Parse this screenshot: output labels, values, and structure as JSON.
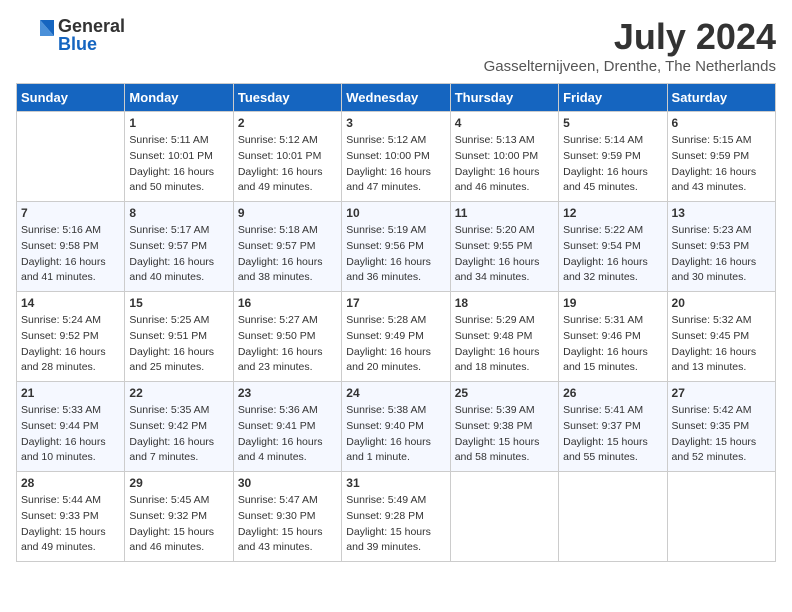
{
  "header": {
    "logo_general": "General",
    "logo_blue": "Blue",
    "month_year": "July 2024",
    "location": "Gasselternijveen, Drenthe, The Netherlands"
  },
  "days_of_week": [
    "Sunday",
    "Monday",
    "Tuesday",
    "Wednesday",
    "Thursday",
    "Friday",
    "Saturday"
  ],
  "weeks": [
    [
      {
        "day": "",
        "content": ""
      },
      {
        "day": "1",
        "content": "Sunrise: 5:11 AM\nSunset: 10:01 PM\nDaylight: 16 hours\nand 50 minutes."
      },
      {
        "day": "2",
        "content": "Sunrise: 5:12 AM\nSunset: 10:01 PM\nDaylight: 16 hours\nand 49 minutes."
      },
      {
        "day": "3",
        "content": "Sunrise: 5:12 AM\nSunset: 10:00 PM\nDaylight: 16 hours\nand 47 minutes."
      },
      {
        "day": "4",
        "content": "Sunrise: 5:13 AM\nSunset: 10:00 PM\nDaylight: 16 hours\nand 46 minutes."
      },
      {
        "day": "5",
        "content": "Sunrise: 5:14 AM\nSunset: 9:59 PM\nDaylight: 16 hours\nand 45 minutes."
      },
      {
        "day": "6",
        "content": "Sunrise: 5:15 AM\nSunset: 9:59 PM\nDaylight: 16 hours\nand 43 minutes."
      }
    ],
    [
      {
        "day": "7",
        "content": "Sunrise: 5:16 AM\nSunset: 9:58 PM\nDaylight: 16 hours\nand 41 minutes."
      },
      {
        "day": "8",
        "content": "Sunrise: 5:17 AM\nSunset: 9:57 PM\nDaylight: 16 hours\nand 40 minutes."
      },
      {
        "day": "9",
        "content": "Sunrise: 5:18 AM\nSunset: 9:57 PM\nDaylight: 16 hours\nand 38 minutes."
      },
      {
        "day": "10",
        "content": "Sunrise: 5:19 AM\nSunset: 9:56 PM\nDaylight: 16 hours\nand 36 minutes."
      },
      {
        "day": "11",
        "content": "Sunrise: 5:20 AM\nSunset: 9:55 PM\nDaylight: 16 hours\nand 34 minutes."
      },
      {
        "day": "12",
        "content": "Sunrise: 5:22 AM\nSunset: 9:54 PM\nDaylight: 16 hours\nand 32 minutes."
      },
      {
        "day": "13",
        "content": "Sunrise: 5:23 AM\nSunset: 9:53 PM\nDaylight: 16 hours\nand 30 minutes."
      }
    ],
    [
      {
        "day": "14",
        "content": "Sunrise: 5:24 AM\nSunset: 9:52 PM\nDaylight: 16 hours\nand 28 minutes."
      },
      {
        "day": "15",
        "content": "Sunrise: 5:25 AM\nSunset: 9:51 PM\nDaylight: 16 hours\nand 25 minutes."
      },
      {
        "day": "16",
        "content": "Sunrise: 5:27 AM\nSunset: 9:50 PM\nDaylight: 16 hours\nand 23 minutes."
      },
      {
        "day": "17",
        "content": "Sunrise: 5:28 AM\nSunset: 9:49 PM\nDaylight: 16 hours\nand 20 minutes."
      },
      {
        "day": "18",
        "content": "Sunrise: 5:29 AM\nSunset: 9:48 PM\nDaylight: 16 hours\nand 18 minutes."
      },
      {
        "day": "19",
        "content": "Sunrise: 5:31 AM\nSunset: 9:46 PM\nDaylight: 16 hours\nand 15 minutes."
      },
      {
        "day": "20",
        "content": "Sunrise: 5:32 AM\nSunset: 9:45 PM\nDaylight: 16 hours\nand 13 minutes."
      }
    ],
    [
      {
        "day": "21",
        "content": "Sunrise: 5:33 AM\nSunset: 9:44 PM\nDaylight: 16 hours\nand 10 minutes."
      },
      {
        "day": "22",
        "content": "Sunrise: 5:35 AM\nSunset: 9:42 PM\nDaylight: 16 hours\nand 7 minutes."
      },
      {
        "day": "23",
        "content": "Sunrise: 5:36 AM\nSunset: 9:41 PM\nDaylight: 16 hours\nand 4 minutes."
      },
      {
        "day": "24",
        "content": "Sunrise: 5:38 AM\nSunset: 9:40 PM\nDaylight: 16 hours\nand 1 minute."
      },
      {
        "day": "25",
        "content": "Sunrise: 5:39 AM\nSunset: 9:38 PM\nDaylight: 15 hours\nand 58 minutes."
      },
      {
        "day": "26",
        "content": "Sunrise: 5:41 AM\nSunset: 9:37 PM\nDaylight: 15 hours\nand 55 minutes."
      },
      {
        "day": "27",
        "content": "Sunrise: 5:42 AM\nSunset: 9:35 PM\nDaylight: 15 hours\nand 52 minutes."
      }
    ],
    [
      {
        "day": "28",
        "content": "Sunrise: 5:44 AM\nSunset: 9:33 PM\nDaylight: 15 hours\nand 49 minutes."
      },
      {
        "day": "29",
        "content": "Sunrise: 5:45 AM\nSunset: 9:32 PM\nDaylight: 15 hours\nand 46 minutes."
      },
      {
        "day": "30",
        "content": "Sunrise: 5:47 AM\nSunset: 9:30 PM\nDaylight: 15 hours\nand 43 minutes."
      },
      {
        "day": "31",
        "content": "Sunrise: 5:49 AM\nSunset: 9:28 PM\nDaylight: 15 hours\nand 39 minutes."
      },
      {
        "day": "",
        "content": ""
      },
      {
        "day": "",
        "content": ""
      },
      {
        "day": "",
        "content": ""
      }
    ]
  ]
}
